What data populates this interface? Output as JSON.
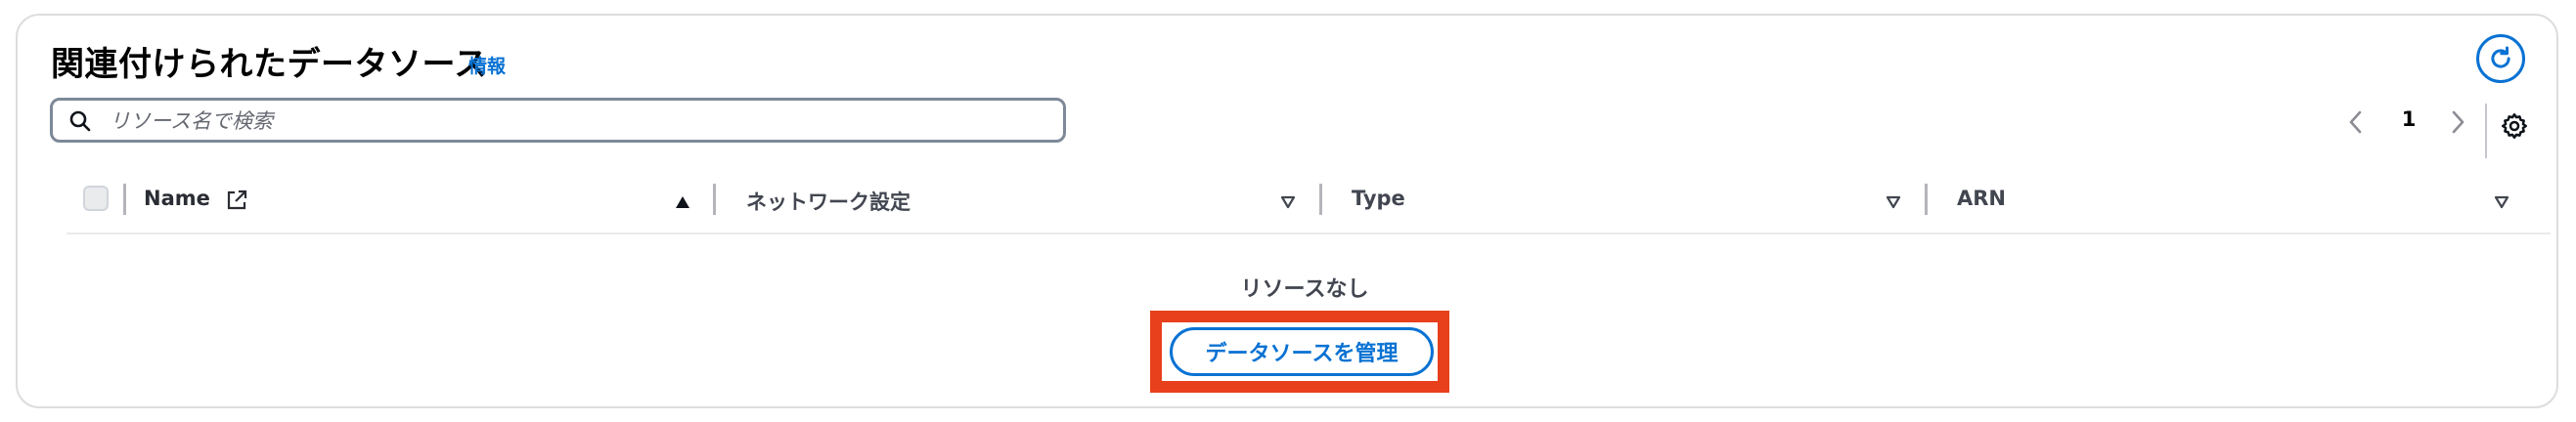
{
  "header": {
    "title": "関連付けられたデータソース",
    "info_link": "情報",
    "refresh_icon": "refresh-icon"
  },
  "search": {
    "placeholder": "リソース名で検索",
    "value": "",
    "icon": "search-icon"
  },
  "pagination": {
    "prev_icon": "chevron-left-icon",
    "current_page": "1",
    "next_icon": "chevron-right-icon",
    "settings_icon": "gear-icon"
  },
  "table": {
    "columns": [
      {
        "label": "Name",
        "icon": "external-link-icon",
        "sort": "ascending"
      },
      {
        "label": "ネットワーク設定",
        "sort": "none"
      },
      {
        "label": "Type",
        "sort": "none"
      },
      {
        "label": "ARN",
        "sort": "none"
      }
    ],
    "rows": []
  },
  "empty_state": {
    "message": "リソースなし",
    "action_label": "データソースを管理"
  },
  "colors": {
    "accent": "#0972d3",
    "highlight": "#e8401c",
    "border": "#dddddd",
    "text_secondary": "#424650"
  }
}
